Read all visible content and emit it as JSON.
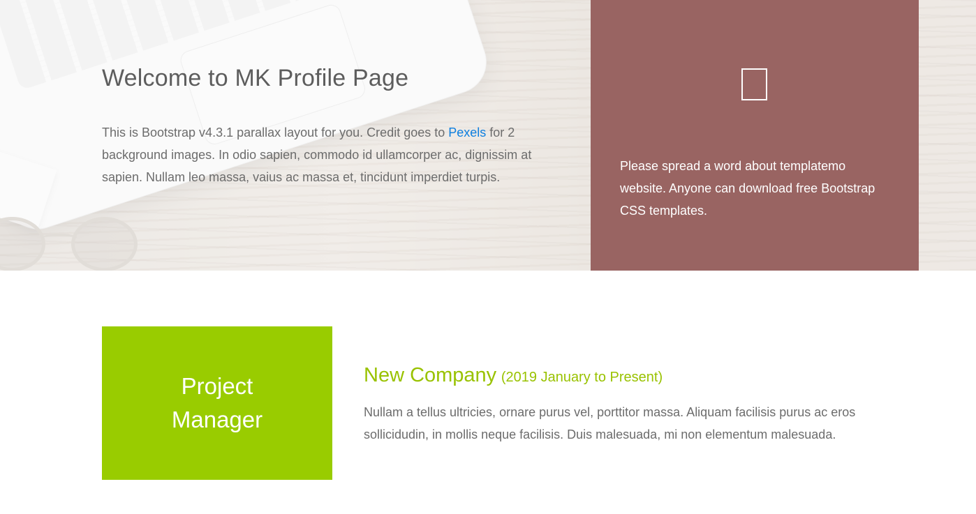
{
  "hero": {
    "title": "Welcome to MK Profile Page",
    "intro_before_link": "This is Bootstrap v4.3.1 parallax layout for you. Credit goes to ",
    "intro_link": "Pexels",
    "intro_after_link": " for 2 background images. In odio sapien, commodo id ullamcorper ac, dignissim at sapien. Nullam leo massa, vaius ac massa et, tincidunt imperdiet turpis."
  },
  "promo": {
    "icon": "square-outline-icon",
    "text": "Please spread a word about templatemo website. Anyone can download free Bootstrap CSS templates.",
    "background_color": "#996462"
  },
  "experience": {
    "role": "Project Manager",
    "company": "New Company",
    "period": "(2019 January to Present)",
    "description": "Nullam a tellus ultricies, ornare purus vel, porttitor massa. Aliquam facilisis purus ac eros sollicidudin, in mollis neque facilisis. Duis malesuada, mi non elementum malesuada.",
    "accent_color": "#99cc00"
  }
}
